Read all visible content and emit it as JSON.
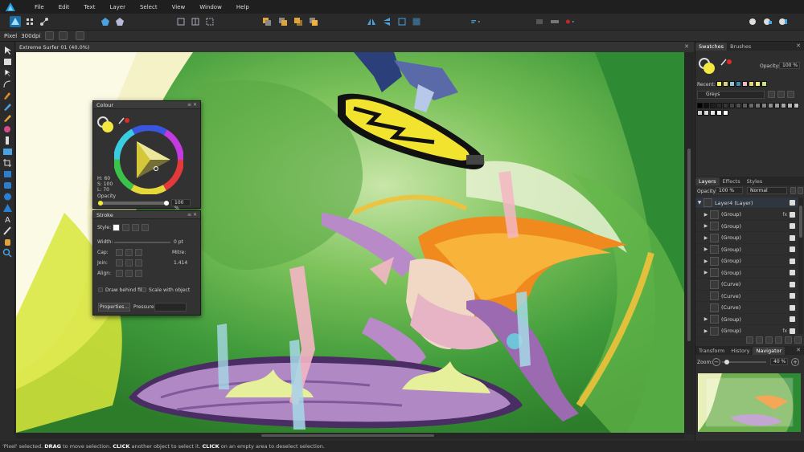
{
  "menu": [
    "File",
    "Edit",
    "Text",
    "Layer",
    "Select",
    "View",
    "Window",
    "Help"
  ],
  "context": {
    "tool": "Pixel",
    "dpi": "300dpi"
  },
  "document": {
    "tab_title": "Extreme Surfer 01 (40.0%)"
  },
  "colour_panel": {
    "title": "Colour",
    "hsl": {
      "h": "H: 60",
      "s": "S: 100",
      "l": "L: 70"
    },
    "opacity_label": "Opacity",
    "opacity_value": "100 %"
  },
  "stroke_panel": {
    "title": "Stroke",
    "style_label": "Style:",
    "width_label": "Width:",
    "width_value": "0 pt",
    "cap_label": "Cap:",
    "mitre_label": "Mitre:",
    "join_label": "Join:",
    "mitre_value": "1.414",
    "align_label": "Align:",
    "draw_behind": "Draw behind fill",
    "scale_with": "Scale with object",
    "properties_btn": "Properties...",
    "pressure_label": "Pressure:"
  },
  "swatches_panel": {
    "tabs": [
      "Swatches",
      "Brushes"
    ],
    "opacity_label": "Opacity:",
    "opacity_value": "100 %",
    "recent_label": "Recent:",
    "palette_name": "Greys",
    "recent_colors": [
      "#f0ea64",
      "#d6d47a",
      "#8fc7d8",
      "#3a8fb5",
      "#f2b8c4",
      "#e6d676",
      "#f4ef7a",
      "#c8e08a"
    ],
    "greys": [
      "#000000",
      "#111111",
      "#1e1e1e",
      "#2a2a2a",
      "#363636",
      "#434343",
      "#4f4f4f",
      "#5c5c5c",
      "#686868",
      "#757575",
      "#818181",
      "#8e8e8e",
      "#9a9a9a",
      "#a7a7a7",
      "#b3b3b3",
      "#c0c0c0",
      "#cccccc",
      "#d9d9d9",
      "#e5e5e5",
      "#f2f2f2",
      "#ffffff"
    ]
  },
  "layers_panel": {
    "tabs": [
      "Layers",
      "Effects",
      "Styles"
    ],
    "opacity_label": "Opacity:",
    "opacity_value": "100 %",
    "blend_mode": "Normal",
    "rows": [
      {
        "name": "Layer4 (Layer)",
        "fx": ""
      },
      {
        "name": "(Group)",
        "fx": "fx"
      },
      {
        "name": "(Group)",
        "fx": ""
      },
      {
        "name": "(Group)",
        "fx": ""
      },
      {
        "name": "(Group)",
        "fx": ""
      },
      {
        "name": "(Group)",
        "fx": ""
      },
      {
        "name": "(Group)",
        "fx": ""
      },
      {
        "name": "(Curve)",
        "fx": ""
      },
      {
        "name": "(Curve)",
        "fx": ""
      },
      {
        "name": "(Curve)",
        "fx": ""
      },
      {
        "name": "(Group)",
        "fx": ""
      },
      {
        "name": "(Group)",
        "fx": "fx"
      }
    ]
  },
  "navigator_panel": {
    "tabs": [
      "Transform",
      "History",
      "Navigator"
    ],
    "zoom_label": "Zoom:",
    "zoom_value": "40 %"
  },
  "status": {
    "p1": "'Pixel' selected. ",
    "k1": "DRAG",
    "p2": " to move selection. ",
    "k2": "CLICK",
    "p3": " another object to select it. ",
    "k3": "CLICK",
    "p4": " on an empty area to deselect selection."
  },
  "colors": {
    "accent": "#1f9bde",
    "fill_yellow": "#f3e83f",
    "stroke_red": "#e02a2a"
  }
}
